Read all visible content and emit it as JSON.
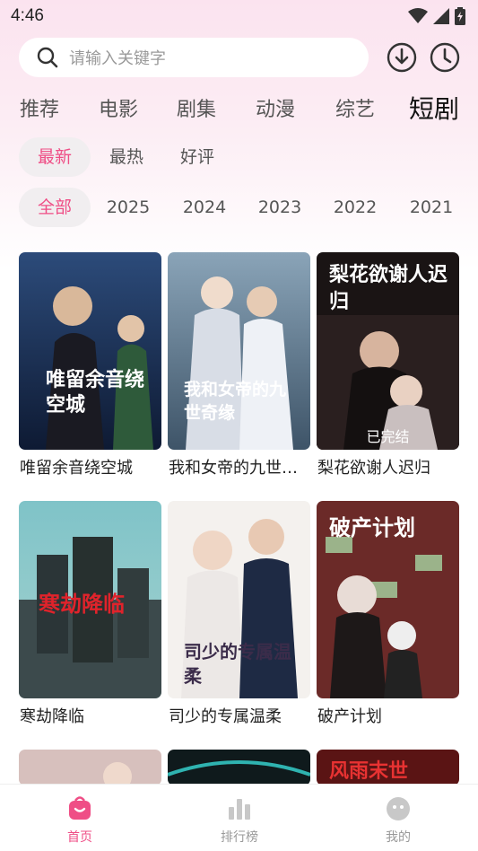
{
  "status": {
    "time": "4:46"
  },
  "search": {
    "placeholder": "请输入关键字"
  },
  "categories": [
    "推荐",
    "电影",
    "剧集",
    "动漫",
    "综艺",
    "短剧"
  ],
  "sort_chips": [
    "最新",
    "最热",
    "好评"
  ],
  "year_chips": [
    "全部",
    "2025",
    "2024",
    "2023",
    "2022",
    "2021"
  ],
  "cards": [
    {
      "title": "唯留余音绕空城",
      "poster_text": "唯留余音绕空城",
      "badge": ""
    },
    {
      "title": "我和女帝的九世奇缘",
      "poster_text": "我和女帝的九世奇缘",
      "badge": ""
    },
    {
      "title": "梨花欲谢人迟归",
      "poster_text": "梨花欲谢人迟归",
      "badge": "已完结"
    },
    {
      "title": "寒劫降临",
      "poster_text": "寒劫降临",
      "badge": ""
    },
    {
      "title": "司少的专属温柔",
      "poster_text": "司少的专属温柔",
      "badge": ""
    },
    {
      "title": "破产计划",
      "poster_text": "破产计划",
      "badge": ""
    },
    {
      "title": "",
      "poster_text": "",
      "badge": ""
    },
    {
      "title": "",
      "poster_text": "",
      "badge": ""
    },
    {
      "title": "",
      "poster_text": "风雨末世",
      "badge": ""
    }
  ],
  "nav": [
    {
      "label": "首页",
      "icon": "home-icon"
    },
    {
      "label": "排行榜",
      "icon": "ranking-icon"
    },
    {
      "label": "我的",
      "icon": "profile-icon"
    }
  ],
  "colors": {
    "accent": "#ef4e86",
    "chip_bg": "#f1eef0"
  }
}
